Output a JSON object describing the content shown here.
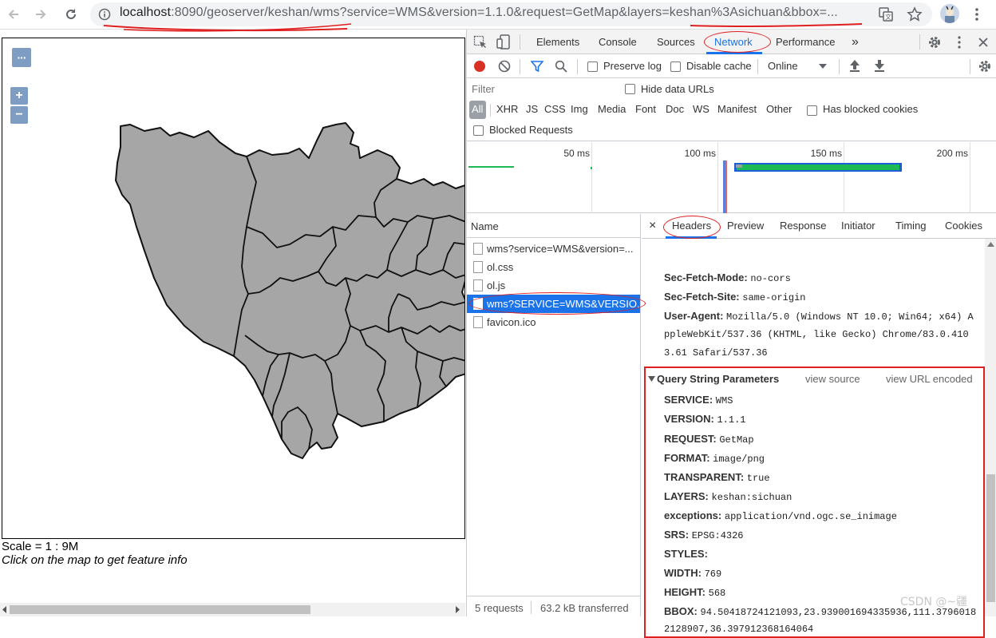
{
  "browser": {
    "url_host": "localhost",
    "url_rest": ":8090/geoserver/keshan/wms?service=WMS&version=1.1.0&request=GetMap&layers=keshan%3Asichuan&bbox=..."
  },
  "map": {
    "scale": "Scale = 1 : 9M",
    "hint": "Click on the map to get feature info",
    "zoom_in": "+",
    "zoom_out": "−",
    "menu": "···",
    "fill_color": "#a6a6a6"
  },
  "devtools": {
    "tabs": [
      "Elements",
      "Console",
      "Sources",
      "Network",
      "Performance"
    ],
    "more_tabs": "»",
    "preserve_log": "Preserve log",
    "disable_cache": "Disable cache",
    "throttle": "Online",
    "filter_placeholder": "Filter",
    "hide_data_urls": "Hide data URLs",
    "types": [
      "All",
      "XHR",
      "JS",
      "CSS",
      "Img",
      "Media",
      "Font",
      "Doc",
      "WS",
      "Manifest",
      "Other"
    ],
    "has_blocked_cookies": "Has blocked cookies",
    "blocked_requests": "Blocked Requests",
    "ticks": [
      "50 ms",
      "100 ms",
      "150 ms",
      "200 ms"
    ],
    "name_header": "Name",
    "requests": [
      "wms?service=WMS&version=...",
      "ol.css",
      "ol.js",
      "wms?SERVICE=WMS&VERSIO...",
      "favicon.ico"
    ],
    "status": {
      "requests": "5 requests",
      "transferred": "63.2 kB transferred"
    },
    "detail_tabs": [
      "Headers",
      "Preview",
      "Response",
      "Initiator",
      "Timing",
      "Cookies"
    ],
    "close": "×",
    "headers": [
      {
        "key": "Sec-Fetch-Mode:",
        "val": "no-cors"
      },
      {
        "key": "Sec-Fetch-Site:",
        "val": "same-origin"
      },
      {
        "key": "User-Agent:",
        "val": "Mozilla/5.0 (Windows NT 10.0; Win64; x64) A"
      }
    ],
    "ua_cont": [
      "ppleWebKit/537.36 (KHTML, like Gecko) Chrome/83.0.410",
      "3.61 Safari/537.36"
    ],
    "qsp_title": "Query String Parameters",
    "view_source": "view source",
    "view_url_encoded": "view URL encoded",
    "params": [
      {
        "key": "SERVICE:",
        "val": "WMS"
      },
      {
        "key": "VERSION:",
        "val": "1.1.1"
      },
      {
        "key": "REQUEST:",
        "val": "GetMap"
      },
      {
        "key": "FORMAT:",
        "val": "image/png"
      },
      {
        "key": "TRANSPARENT:",
        "val": "true"
      },
      {
        "key": "LAYERS:",
        "val": "keshan:sichuan"
      },
      {
        "key": "exceptions:",
        "val": "application/vnd.ogc.se_inimage"
      },
      {
        "key": "SRS:",
        "val": "EPSG:4326"
      },
      {
        "key": "STYLES:",
        "val": ""
      },
      {
        "key": "WIDTH:",
        "val": "769"
      },
      {
        "key": "HEIGHT:",
        "val": "568"
      },
      {
        "key": "BBOX:",
        "val": "94.50418724121093,23.939001694335936,111.3796018"
      }
    ],
    "bbox_cont": "2128907,36.397912368164064"
  },
  "watermark": "CSDN @~疆"
}
